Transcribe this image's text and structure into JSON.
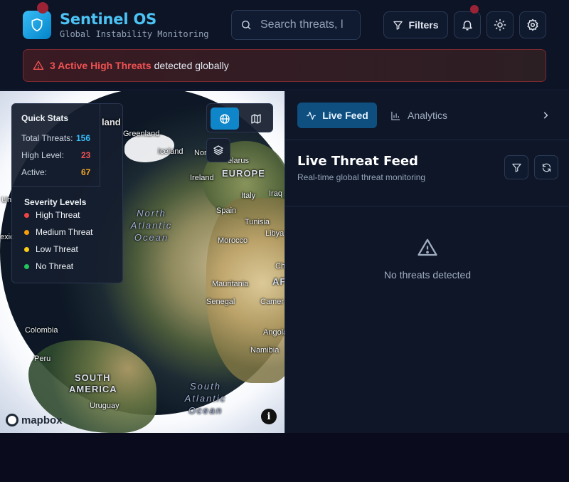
{
  "header": {
    "brand_title": "Sentinel OS",
    "brand_subtitle": "Global Instability Monitoring",
    "search_placeholder": "Search threats, l",
    "filters_label": "Filters",
    "icons": [
      "shield-icon",
      "search-icon",
      "filter-icon",
      "bell-icon",
      "sun-icon",
      "gear-icon"
    ]
  },
  "alert": {
    "highlight": "3 Active High Threats",
    "text": "detected globally",
    "color": "#f05252"
  },
  "map": {
    "quick_stats": {
      "title": "Quick Stats",
      "rows": [
        {
          "label": "Total Threats:",
          "value": "156",
          "color": "#38bdf8"
        },
        {
          "label": "High Level:",
          "value": "23",
          "color": "#f05252"
        },
        {
          "label": "Active:",
          "value": "67",
          "color": "#f5a623"
        }
      ]
    },
    "severity": {
      "title": "Severity Levels",
      "items": [
        {
          "label": "High Threat",
          "color": "#ef4444"
        },
        {
          "label": "Medium Threat",
          "color": "#f59e0b"
        },
        {
          "label": "Low Threat",
          "color": "#facc15"
        },
        {
          "label": "No Threat",
          "color": "#22c55e"
        }
      ]
    },
    "labels": {
      "greenland": "Greenland",
      "iceland": "Iceland",
      "ireland": "Ireland",
      "europe": "EUROPE",
      "italy": "Italy",
      "spain": "Spain",
      "tunisia": "Tunisia",
      "libya": "Libya",
      "morocco": "Morocco",
      "mauritania": "Mauritania",
      "senegal": "Senegal",
      "cameroon": "Camer",
      "angola": "Angola",
      "namibia": "Namibia",
      "colombia": "Colombia",
      "peru": "Peru",
      "south_america_1": "SOUTH",
      "south_america_2": "AMERICA",
      "uruguay": "Uruguay",
      "north_atlantic_1": "North",
      "north_atlantic_2": "Atlantic",
      "north_atlantic_3": "Ocean",
      "south_atlantic_1": "South",
      "south_atlantic_2": "Atlantic",
      "south_atlantic_3": "Ocean",
      "partial_land": "land",
      "partial_nor": "Nor",
      "partial_belarus": "elarus",
      "partial_iraq": "Iraq",
      "partial_ch": "Ch",
      "partial_af": "AF",
      "partial_un": "Un",
      "partial_exic": "exic"
    },
    "attribution": "mapbox",
    "info_label": "i"
  },
  "panel": {
    "tab_live": "Live Feed",
    "tab_analytics": "Analytics",
    "feed_title": "Live Threat Feed",
    "feed_subtitle": "Real-time global threat monitoring",
    "empty_text": "No threats detected"
  }
}
